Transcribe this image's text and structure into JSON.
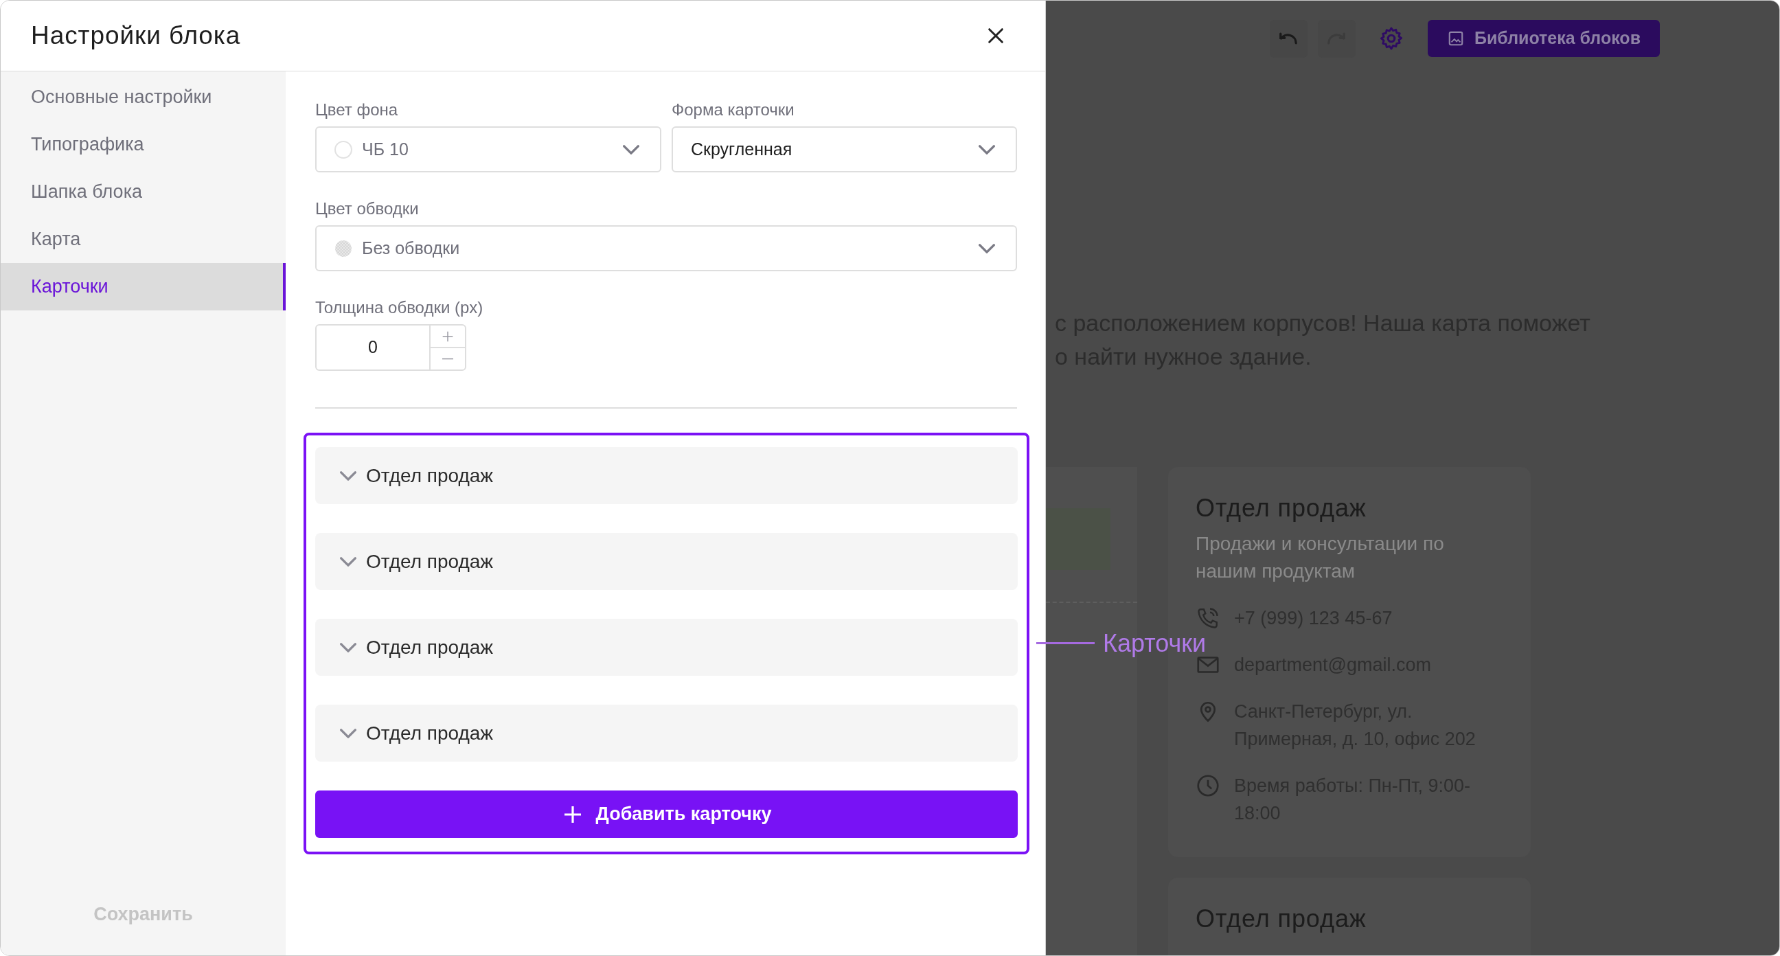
{
  "modal": {
    "title": "Настройки блока"
  },
  "nav": [
    {
      "label": "Основные настройки",
      "selected": false
    },
    {
      "label": "Типографика",
      "selected": false
    },
    {
      "label": "Шапка блока",
      "selected": false
    },
    {
      "label": "Карта",
      "selected": false
    },
    {
      "label": "Карточки",
      "selected": true
    }
  ],
  "save_button": {
    "label": "Сохранить",
    "disabled": true
  },
  "fields": {
    "background_color": {
      "label": "Цвет фона",
      "value": "ЧБ 10",
      "swatch": {
        "kind": "color",
        "color": "#ffffff"
      }
    },
    "card_shape": {
      "label": "Форма карточки",
      "value": "Скругленная"
    },
    "border_color": {
      "label": "Цвет обводки",
      "value": "Без обводки",
      "swatch": {
        "kind": "transparent"
      }
    },
    "border_width": {
      "label": "Толщина обводки (px)",
      "value": "0"
    }
  },
  "cards": [
    {
      "title": "Отдел продаж",
      "expanded": false
    },
    {
      "title": "Отдел продаж",
      "expanded": false
    },
    {
      "title": "Отдел продаж",
      "expanded": false
    },
    {
      "title": "Отдел продаж",
      "expanded": false
    }
  ],
  "add_card_button": {
    "label": "Добавить карточку"
  },
  "callout": {
    "label": "Карточки"
  },
  "preview": {
    "toolbar": {
      "undo_disabled": false,
      "redo_disabled": true,
      "library_button": "Библиотека блоков"
    },
    "intro_lines": [
      "с расположением корпусов! Наша карта поможет",
      "о найти нужное здание."
    ],
    "cards": [
      {
        "title": "Отдел продаж",
        "description": "Продажи и консультации по нашим продуктам",
        "contacts": [
          {
            "kind": "phone",
            "text": "+7 (999) 123 45-67"
          },
          {
            "kind": "email",
            "text": "department@gmail.com"
          },
          {
            "kind": "address",
            "text": "Санкт-Петербург, ул. Примерная, д. 10, офис 202"
          },
          {
            "kind": "hours",
            "text": "Время работы: Пн-Пт, 9:00-18:00"
          }
        ]
      },
      {
        "title": "Отдел продаж"
      }
    ]
  }
}
